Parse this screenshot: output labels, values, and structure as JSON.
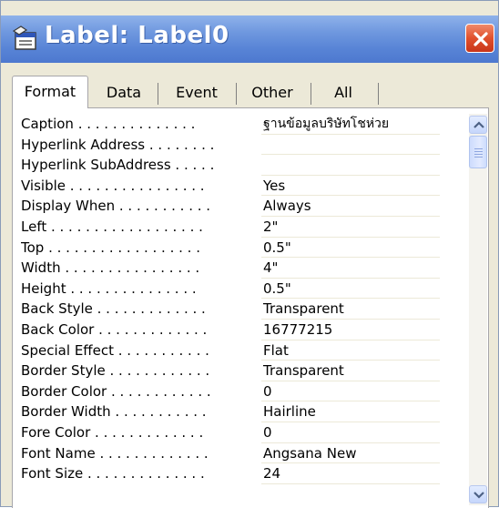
{
  "window": {
    "title": "Label: Label0",
    "icon": "properties-sheet-icon",
    "close_icon": "close-icon",
    "colors": {
      "titlebar": "#5884d6",
      "close": "#e0502d",
      "face": "#ece9d8"
    }
  },
  "tabs": [
    {
      "label": "Format",
      "active": true
    },
    {
      "label": "Data",
      "active": false
    },
    {
      "label": "Event",
      "active": false
    },
    {
      "label": "Other",
      "active": false
    },
    {
      "label": "All",
      "active": false
    }
  ],
  "properties": [
    {
      "name": "Caption . . . . . . . . . . . . . .",
      "value": "ฐานข้อมูลบริษัทโชห่วย"
    },
    {
      "name": "Hyperlink Address . . . . . . . .",
      "value": ""
    },
    {
      "name": "Hyperlink SubAddress . . . . .",
      "value": ""
    },
    {
      "name": "Visible . . . . . . . . . . . . . . . .",
      "value": "Yes"
    },
    {
      "name": "Display When . . . . . . . . . . .",
      "value": "Always"
    },
    {
      "name": "Left . . . . . . . . . . . . . . . . . .",
      "value": "2\""
    },
    {
      "name": "Top . . . . . . . . . . . . . . . . . .",
      "value": "0.5\""
    },
    {
      "name": "Width . . . . . . . . . . . . . . . .",
      "value": "4\""
    },
    {
      "name": "Height . . . . . . . . . . . . . . .",
      "value": "0.5\""
    },
    {
      "name": "Back Style . . . . . . . . . . . . .",
      "value": "Transparent"
    },
    {
      "name": "Back Color . . . . . . . . . . . . .",
      "value": "16777215"
    },
    {
      "name": "Special Effect . . . . . . . . . . .",
      "value": "Flat"
    },
    {
      "name": "Border Style . . . . . . . . . . . .",
      "value": "Transparent"
    },
    {
      "name": "Border Color . . . . . . . . . . . .",
      "value": "0"
    },
    {
      "name": "Border Width . . . . . . . . . . .",
      "value": "Hairline"
    },
    {
      "name": "Fore Color . . . . . . . . . . . . .",
      "value": "0"
    },
    {
      "name": "Font Name . . . . . . . . . . . . .",
      "value": "Angsana New"
    },
    {
      "name": "Font Size . . . . . . . . . . . . . .",
      "value": "24"
    }
  ],
  "scrollbar": {
    "up_icon": "scroll-up-arrow-icon",
    "down_icon": "scroll-down-arrow-icon"
  }
}
